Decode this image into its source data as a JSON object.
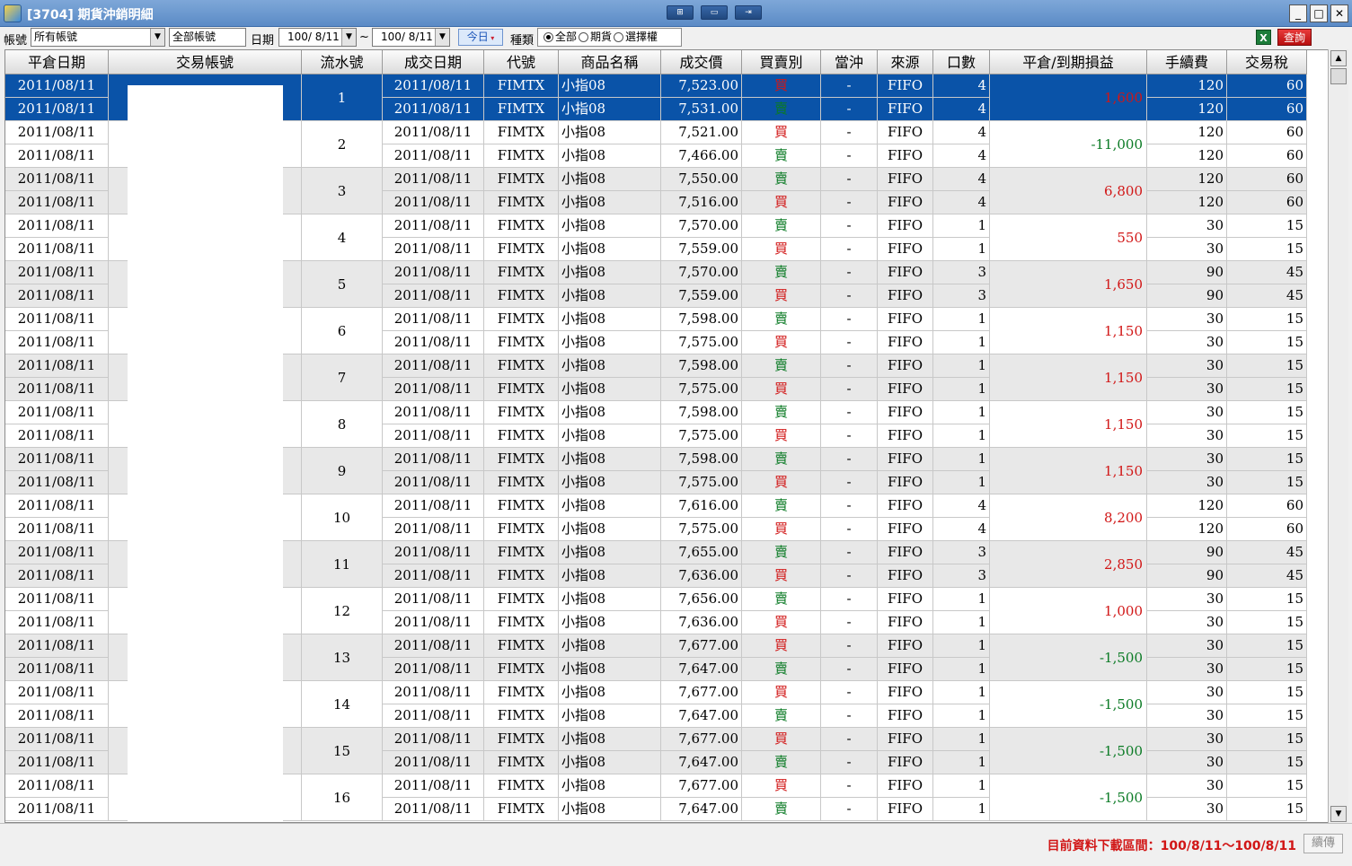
{
  "window": {
    "title": "[3704] 期貨沖銷明細",
    "controls": [
      "_",
      "□",
      "✕"
    ]
  },
  "toolbar": {
    "account_label": "帳號",
    "account_value": "所有帳號",
    "account_name_value": "全部帳號",
    "date_label": "日期",
    "date_from": "100/ 8/11",
    "date_sep": "~",
    "date_to": "100/ 8/11",
    "today_label": "今日",
    "type_label": "種類",
    "type_options": [
      "全部",
      "期貨",
      "選擇權"
    ],
    "type_selected": "全部",
    "excel_icon": "excel-icon",
    "query_label": "查詢"
  },
  "grid": {
    "columns": [
      "平倉日期",
      "交易帳號",
      "流水號",
      "成交日期",
      "代號",
      "商品名稱",
      "成交價",
      "買賣別",
      "當沖",
      "來源",
      "口數",
      "平倉/到期損益",
      "手續費",
      "交易稅"
    ],
    "groups": [
      {
        "serial": "1",
        "pnl": "1,600",
        "rows": [
          {
            "close_date": "2011/08/11",
            "trade_date": "2011/08/11",
            "code": "FIMTX",
            "name": "小指08",
            "price": "7,523.00",
            "side": "買",
            "daytrade": "-",
            "source": "FIFO",
            "qty": "4",
            "fee": "120",
            "tax": "60"
          },
          {
            "close_date": "2011/08/11",
            "trade_date": "2011/08/11",
            "code": "FIMTX",
            "name": "小指08",
            "price": "7,531.00",
            "side": "賣",
            "daytrade": "-",
            "source": "FIFO",
            "qty": "4",
            "fee": "120",
            "tax": "60"
          }
        ]
      },
      {
        "serial": "2",
        "pnl": "-11,000",
        "rows": [
          {
            "close_date": "2011/08/11",
            "trade_date": "2011/08/11",
            "code": "FIMTX",
            "name": "小指08",
            "price": "7,521.00",
            "side": "買",
            "daytrade": "-",
            "source": "FIFO",
            "qty": "4",
            "fee": "120",
            "tax": "60"
          },
          {
            "close_date": "2011/08/11",
            "trade_date": "2011/08/11",
            "code": "FIMTX",
            "name": "小指08",
            "price": "7,466.00",
            "side": "賣",
            "daytrade": "-",
            "source": "FIFO",
            "qty": "4",
            "fee": "120",
            "tax": "60"
          }
        ]
      },
      {
        "serial": "3",
        "pnl": "6,800",
        "rows": [
          {
            "close_date": "2011/08/11",
            "trade_date": "2011/08/11",
            "code": "FIMTX",
            "name": "小指08",
            "price": "7,550.00",
            "side": "賣",
            "daytrade": "-",
            "source": "FIFO",
            "qty": "4",
            "fee": "120",
            "tax": "60"
          },
          {
            "close_date": "2011/08/11",
            "trade_date": "2011/08/11",
            "code": "FIMTX",
            "name": "小指08",
            "price": "7,516.00",
            "side": "買",
            "daytrade": "-",
            "source": "FIFO",
            "qty": "4",
            "fee": "120",
            "tax": "60"
          }
        ]
      },
      {
        "serial": "4",
        "pnl": "550",
        "rows": [
          {
            "close_date": "2011/08/11",
            "trade_date": "2011/08/11",
            "code": "FIMTX",
            "name": "小指08",
            "price": "7,570.00",
            "side": "賣",
            "daytrade": "-",
            "source": "FIFO",
            "qty": "1",
            "fee": "30",
            "tax": "15"
          },
          {
            "close_date": "2011/08/11",
            "trade_date": "2011/08/11",
            "code": "FIMTX",
            "name": "小指08",
            "price": "7,559.00",
            "side": "買",
            "daytrade": "-",
            "source": "FIFO",
            "qty": "1",
            "fee": "30",
            "tax": "15"
          }
        ]
      },
      {
        "serial": "5",
        "pnl": "1,650",
        "rows": [
          {
            "close_date": "2011/08/11",
            "trade_date": "2011/08/11",
            "code": "FIMTX",
            "name": "小指08",
            "price": "7,570.00",
            "side": "賣",
            "daytrade": "-",
            "source": "FIFO",
            "qty": "3",
            "fee": "90",
            "tax": "45"
          },
          {
            "close_date": "2011/08/11",
            "trade_date": "2011/08/11",
            "code": "FIMTX",
            "name": "小指08",
            "price": "7,559.00",
            "side": "買",
            "daytrade": "-",
            "source": "FIFO",
            "qty": "3",
            "fee": "90",
            "tax": "45"
          }
        ]
      },
      {
        "serial": "6",
        "pnl": "1,150",
        "rows": [
          {
            "close_date": "2011/08/11",
            "trade_date": "2011/08/11",
            "code": "FIMTX",
            "name": "小指08",
            "price": "7,598.00",
            "side": "賣",
            "daytrade": "-",
            "source": "FIFO",
            "qty": "1",
            "fee": "30",
            "tax": "15"
          },
          {
            "close_date": "2011/08/11",
            "trade_date": "2011/08/11",
            "code": "FIMTX",
            "name": "小指08",
            "price": "7,575.00",
            "side": "買",
            "daytrade": "-",
            "source": "FIFO",
            "qty": "1",
            "fee": "30",
            "tax": "15"
          }
        ]
      },
      {
        "serial": "7",
        "pnl": "1,150",
        "rows": [
          {
            "close_date": "2011/08/11",
            "trade_date": "2011/08/11",
            "code": "FIMTX",
            "name": "小指08",
            "price": "7,598.00",
            "side": "賣",
            "daytrade": "-",
            "source": "FIFO",
            "qty": "1",
            "fee": "30",
            "tax": "15"
          },
          {
            "close_date": "2011/08/11",
            "trade_date": "2011/08/11",
            "code": "FIMTX",
            "name": "小指08",
            "price": "7,575.00",
            "side": "買",
            "daytrade": "-",
            "source": "FIFO",
            "qty": "1",
            "fee": "30",
            "tax": "15"
          }
        ]
      },
      {
        "serial": "8",
        "pnl": "1,150",
        "rows": [
          {
            "close_date": "2011/08/11",
            "trade_date": "2011/08/11",
            "code": "FIMTX",
            "name": "小指08",
            "price": "7,598.00",
            "side": "賣",
            "daytrade": "-",
            "source": "FIFO",
            "qty": "1",
            "fee": "30",
            "tax": "15"
          },
          {
            "close_date": "2011/08/11",
            "trade_date": "2011/08/11",
            "code": "FIMTX",
            "name": "小指08",
            "price": "7,575.00",
            "side": "買",
            "daytrade": "-",
            "source": "FIFO",
            "qty": "1",
            "fee": "30",
            "tax": "15"
          }
        ]
      },
      {
        "serial": "9",
        "pnl": "1,150",
        "rows": [
          {
            "close_date": "2011/08/11",
            "trade_date": "2011/08/11",
            "code": "FIMTX",
            "name": "小指08",
            "price": "7,598.00",
            "side": "賣",
            "daytrade": "-",
            "source": "FIFO",
            "qty": "1",
            "fee": "30",
            "tax": "15"
          },
          {
            "close_date": "2011/08/11",
            "trade_date": "2011/08/11",
            "code": "FIMTX",
            "name": "小指08",
            "price": "7,575.00",
            "side": "買",
            "daytrade": "-",
            "source": "FIFO",
            "qty": "1",
            "fee": "30",
            "tax": "15"
          }
        ]
      },
      {
        "serial": "10",
        "pnl": "8,200",
        "rows": [
          {
            "close_date": "2011/08/11",
            "trade_date": "2011/08/11",
            "code": "FIMTX",
            "name": "小指08",
            "price": "7,616.00",
            "side": "賣",
            "daytrade": "-",
            "source": "FIFO",
            "qty": "4",
            "fee": "120",
            "tax": "60"
          },
          {
            "close_date": "2011/08/11",
            "trade_date": "2011/08/11",
            "code": "FIMTX",
            "name": "小指08",
            "price": "7,575.00",
            "side": "買",
            "daytrade": "-",
            "source": "FIFO",
            "qty": "4",
            "fee": "120",
            "tax": "60"
          }
        ]
      },
      {
        "serial": "11",
        "pnl": "2,850",
        "rows": [
          {
            "close_date": "2011/08/11",
            "trade_date": "2011/08/11",
            "code": "FIMTX",
            "name": "小指08",
            "price": "7,655.00",
            "side": "賣",
            "daytrade": "-",
            "source": "FIFO",
            "qty": "3",
            "fee": "90",
            "tax": "45"
          },
          {
            "close_date": "2011/08/11",
            "trade_date": "2011/08/11",
            "code": "FIMTX",
            "name": "小指08",
            "price": "7,636.00",
            "side": "買",
            "daytrade": "-",
            "source": "FIFO",
            "qty": "3",
            "fee": "90",
            "tax": "45"
          }
        ]
      },
      {
        "serial": "12",
        "pnl": "1,000",
        "rows": [
          {
            "close_date": "2011/08/11",
            "trade_date": "2011/08/11",
            "code": "FIMTX",
            "name": "小指08",
            "price": "7,656.00",
            "side": "賣",
            "daytrade": "-",
            "source": "FIFO",
            "qty": "1",
            "fee": "30",
            "tax": "15"
          },
          {
            "close_date": "2011/08/11",
            "trade_date": "2011/08/11",
            "code": "FIMTX",
            "name": "小指08",
            "price": "7,636.00",
            "side": "買",
            "daytrade": "-",
            "source": "FIFO",
            "qty": "1",
            "fee": "30",
            "tax": "15"
          }
        ]
      },
      {
        "serial": "13",
        "pnl": "-1,500",
        "rows": [
          {
            "close_date": "2011/08/11",
            "trade_date": "2011/08/11",
            "code": "FIMTX",
            "name": "小指08",
            "price": "7,677.00",
            "side": "買",
            "daytrade": "-",
            "source": "FIFO",
            "qty": "1",
            "fee": "30",
            "tax": "15"
          },
          {
            "close_date": "2011/08/11",
            "trade_date": "2011/08/11",
            "code": "FIMTX",
            "name": "小指08",
            "price": "7,647.00",
            "side": "賣",
            "daytrade": "-",
            "source": "FIFO",
            "qty": "1",
            "fee": "30",
            "tax": "15"
          }
        ]
      },
      {
        "serial": "14",
        "pnl": "-1,500",
        "rows": [
          {
            "close_date": "2011/08/11",
            "trade_date": "2011/08/11",
            "code": "FIMTX",
            "name": "小指08",
            "price": "7,677.00",
            "side": "買",
            "daytrade": "-",
            "source": "FIFO",
            "qty": "1",
            "fee": "30",
            "tax": "15"
          },
          {
            "close_date": "2011/08/11",
            "trade_date": "2011/08/11",
            "code": "FIMTX",
            "name": "小指08",
            "price": "7,647.00",
            "side": "賣",
            "daytrade": "-",
            "source": "FIFO",
            "qty": "1",
            "fee": "30",
            "tax": "15"
          }
        ]
      },
      {
        "serial": "15",
        "pnl": "-1,500",
        "rows": [
          {
            "close_date": "2011/08/11",
            "trade_date": "2011/08/11",
            "code": "FIMTX",
            "name": "小指08",
            "price": "7,677.00",
            "side": "買",
            "daytrade": "-",
            "source": "FIFO",
            "qty": "1",
            "fee": "30",
            "tax": "15"
          },
          {
            "close_date": "2011/08/11",
            "trade_date": "2011/08/11",
            "code": "FIMTX",
            "name": "小指08",
            "price": "7,647.00",
            "side": "賣",
            "daytrade": "-",
            "source": "FIFO",
            "qty": "1",
            "fee": "30",
            "tax": "15"
          }
        ]
      },
      {
        "serial": "16",
        "pnl": "-1,500",
        "rows": [
          {
            "close_date": "2011/08/11",
            "trade_date": "2011/08/11",
            "code": "FIMTX",
            "name": "小指08",
            "price": "7,677.00",
            "side": "買",
            "daytrade": "-",
            "source": "FIFO",
            "qty": "1",
            "fee": "30",
            "tax": "15"
          },
          {
            "close_date": "2011/08/11",
            "trade_date": "2011/08/11",
            "code": "FIMTX",
            "name": "小指08",
            "price": "7,647.00",
            "side": "賣",
            "daytrade": "-",
            "source": "FIFO",
            "qty": "1",
            "fee": "30",
            "tax": "15"
          }
        ]
      }
    ]
  },
  "status": {
    "download_range": "目前資料下載區間：100/8/11～100/8/11",
    "continue_label": "續傳"
  },
  "colors": {
    "selected_row": "#0a53a8",
    "alt_row": "#e8e8e8",
    "buy": "#d11616",
    "sell": "#0a7a24",
    "status_text": "#d11616"
  }
}
